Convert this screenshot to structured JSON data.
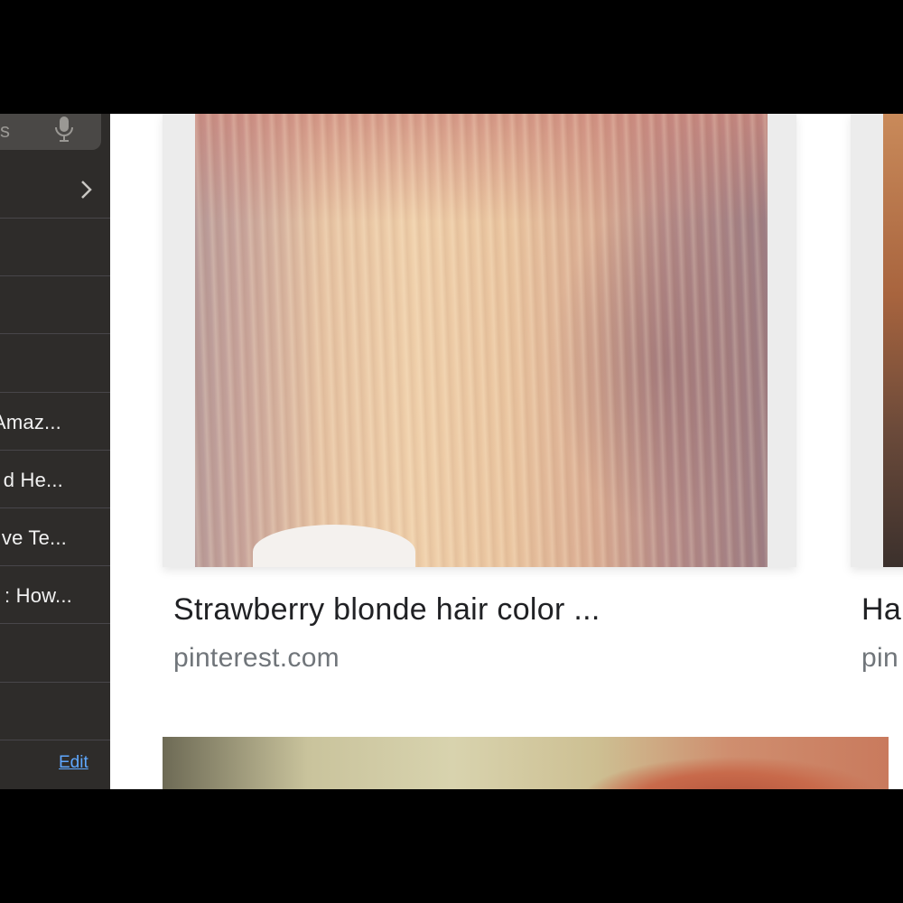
{
  "sidebar": {
    "search_text": "s",
    "rows": [
      {
        "label": ""
      },
      {
        "label": ""
      },
      {
        "label": ""
      },
      {
        "label": ""
      },
      {
        "label": "Amaz..."
      },
      {
        "label": "d He..."
      },
      {
        "label": "ve Te..."
      },
      {
        "label": ": How..."
      },
      {
        "label": ""
      },
      {
        "label": ""
      }
    ],
    "edit_label": "Edit"
  },
  "results": [
    {
      "title": "Strawberry blonde hair color ...",
      "source": "pinterest.com"
    },
    {
      "title": "Ha",
      "source": "pin"
    }
  ],
  "colors": {
    "sidebar_bg": "#2e2c2a",
    "link": "#5fa8ff",
    "title_text": "#202124",
    "source_text": "#70757a"
  },
  "icons": [
    "mic-icon",
    "chevron-right-icon"
  ]
}
